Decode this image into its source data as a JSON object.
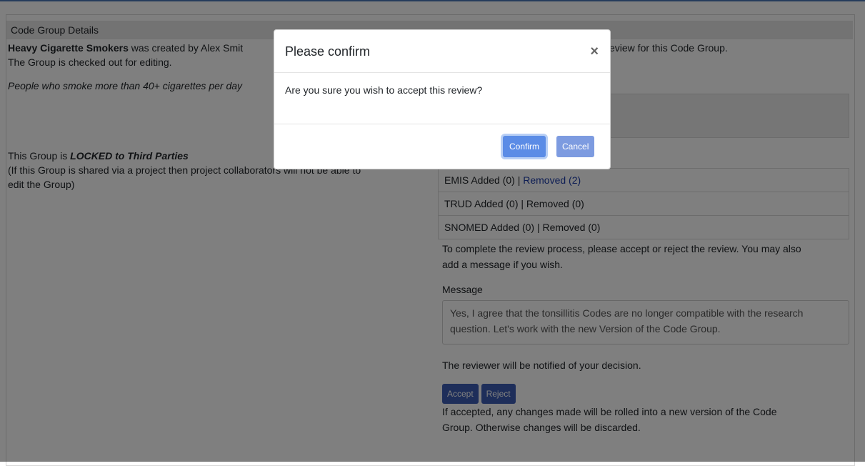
{
  "panel": {
    "header": "Code Group Details"
  },
  "left": {
    "group_name": "Heavy Cigarette Smokers",
    "created_by": " was created by Alex Smit",
    "checked_out": "The Group is checked out for editing.",
    "description": "People who smoke more than 40+ cigarettes per day",
    "lock_prefix": "This Group is ",
    "lock_status": "LOCKED to Third Parties",
    "lock_note_line1": "(If this Group is shared via a project then project colla",
    "lock_note_line1b": "borators will not be able to",
    "lock_note_line2": "edit the Group)"
  },
  "right": {
    "review_text": "eview for this Code Group.",
    "changes": [
      {
        "label": "EMIS Added (0) | ",
        "link": "Removed (2)"
      },
      {
        "label": "TRUD Added (0) | Removed (0)",
        "link": ""
      },
      {
        "label": "SNOMED Added (0) | Removed (0)",
        "link": ""
      }
    ],
    "instructions_line1": "To complete the review process, please accept or reject the review. You may also",
    "instructions_line2": "add a message if you wish.",
    "message_label": "Message",
    "message_text": "Yes, I agree that the tonsillitis Codes are no longer compatible with the research question. Let's work with the new Version of the Code Group.",
    "notify_text": "The reviewer will be notified of your decision.",
    "accept_label": "Accept",
    "reject_label": "Reject",
    "outcome_line1": "If accepted, any changes made will be rolled into a new version of the Code",
    "outcome_line2": "Group. Otherwise changes will be discarded."
  },
  "modal": {
    "title": "Please confirm",
    "close_glyph": "×",
    "body": "Are you sure you wish to accept this review?",
    "confirm_label": "Confirm",
    "cancel_label": "Cancel"
  }
}
